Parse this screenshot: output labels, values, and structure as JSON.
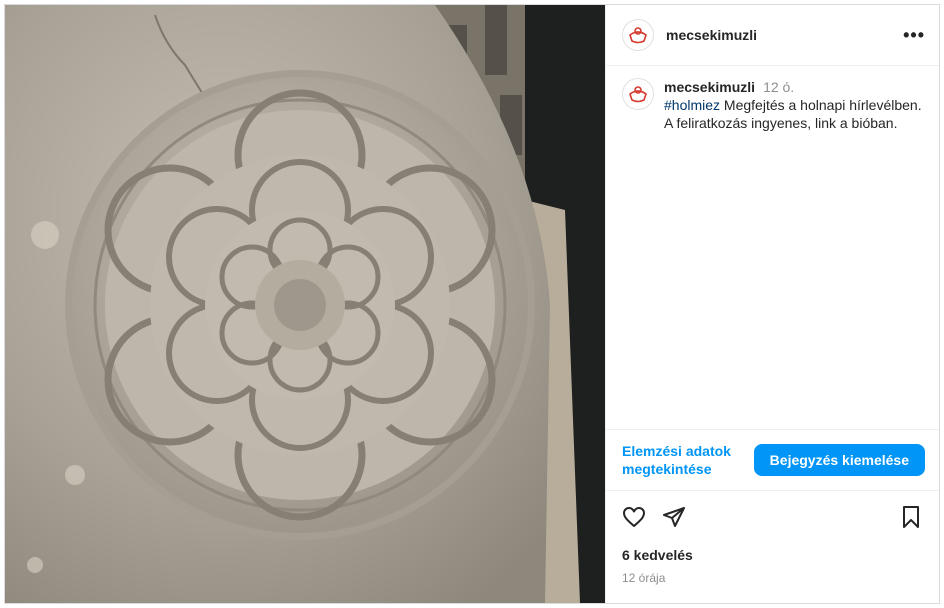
{
  "post": {
    "username": "mecsekimuzli",
    "more_icon": "more-options-icon",
    "brand_color": "#d63a2f"
  },
  "caption": {
    "username": "mecsekimuzli",
    "time": "12 ó.",
    "hashtag": "#holmiez",
    "text": " Megfejtés a holnapi hírlevélben. A feliratkozás ingyenes, link a bióban."
  },
  "promo": {
    "insights_label": "Elemzési adatok megtekintése",
    "boost_label": "Bejegyzés kiemelése",
    "accent": "#0095f6"
  },
  "actions": {
    "like_icon": "heart-icon",
    "share_icon": "paper-plane-icon",
    "save_icon": "bookmark-icon"
  },
  "stats": {
    "likes": "6 kedvelés",
    "time_ago": "12 órája"
  }
}
